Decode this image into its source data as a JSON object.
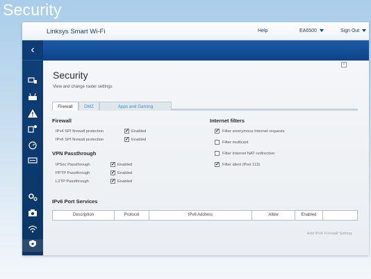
{
  "slide_title": "Security",
  "topbar": {
    "brand": "Linksys Smart Wi-Fi",
    "help": "Help",
    "router_model": "EA6500",
    "sign_out": "Sign Out"
  },
  "sidebar": {
    "back_glyph": "‹",
    "icons": [
      "devices-icon",
      "router-icon",
      "alert-icon",
      "parental-icon",
      "speed-icon",
      "storage-icon",
      "settings-icon",
      "camera-icon",
      "wifi-icon",
      "security-icon"
    ]
  },
  "page": {
    "title": "Security",
    "subtitle": "View and change router settings",
    "close_glyph": "×"
  },
  "tabs": [
    "Firewall",
    "DMZ",
    "Apps and Gaming"
  ],
  "firewall": {
    "heading": "Firewall",
    "rows": [
      {
        "label": "IPv4 SPI firewall protection",
        "state": "Enabled",
        "checked": true
      },
      {
        "label": "IPv6 SPI firewall protection",
        "state": "Enabled",
        "checked": true
      }
    ]
  },
  "vpn": {
    "heading": "VPN Passthrough",
    "rows": [
      {
        "label": "IPSec Passthrough",
        "state": "Enabled",
        "checked": true
      },
      {
        "label": "PPTP Passthrough",
        "state": "Enabled",
        "checked": true
      },
      {
        "label": "L2TP Passthrough",
        "state": "Enabled",
        "checked": true
      }
    ]
  },
  "internet_filters": {
    "heading": "Internet filters",
    "items": [
      {
        "label": "Filter anonymous Internet requests",
        "checked": true
      },
      {
        "label": "Filter multicast",
        "checked": false
      },
      {
        "label": "Filter Internet NAT redirection",
        "checked": false
      },
      {
        "label": "Filter ident (Port 113)",
        "checked": true
      }
    ]
  },
  "ipv6_services": {
    "heading": "IPv6 Port Services",
    "columns": [
      "Description",
      "Protocol",
      "IPv6 Address",
      "Allow",
      "Enabled"
    ],
    "add_button": "Add IPv6 Firewall Setting"
  },
  "colors": {
    "header_blue": "#0d4388",
    "sidebar_blue": "#0f3f77",
    "link_blue": "#3f8fc9"
  }
}
